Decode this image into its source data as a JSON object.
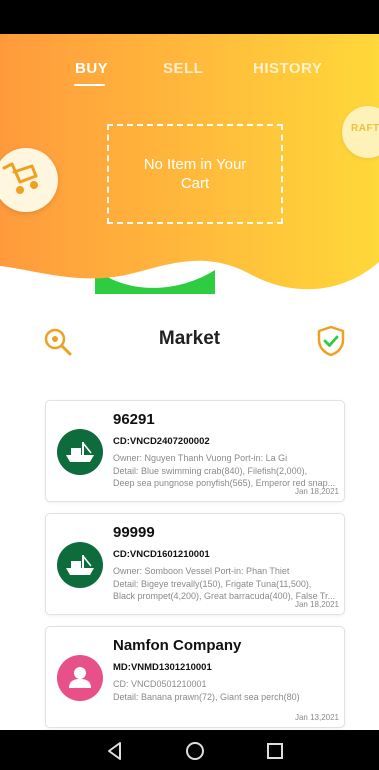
{
  "tabs": [
    {
      "label": "BUY",
      "active": true
    },
    {
      "label": "SELL",
      "active": false
    },
    {
      "label": "HISTORY",
      "active": false
    }
  ],
  "cart": {
    "empty_message": "No Item in Your Cart"
  },
  "hero": {
    "badge_text": "RAFT",
    "gradient_start": "#ff9a3c",
    "gradient_end": "#ffd83a",
    "wave_accent": "#2ecc40"
  },
  "market": {
    "title": "Market"
  },
  "listings": [
    {
      "name": "96291",
      "code": "CD:VNCD2407200002",
      "owner_line": "Owner: Nguyen Thanh Vuong  Port-in: La Gi",
      "detail_line1": "Detail: Blue swimming crab(840), Filefish(2,000),",
      "detail_line2": "Deep sea pungnose ponyfish(565), Emperor red snap...",
      "date": "Jan 18,2021",
      "avatar_icon": "boat-icon"
    },
    {
      "name": "99999",
      "code": "CD:VNCD1601210001",
      "owner_line": "Owner: Somboon Vessel  Port-in: Phan Thiet",
      "detail_line1": "Detail: Bigeye trevally(150), Frigate Tuna(11,500),",
      "detail_line2": "Black prompet(4,200), Great barracuda(400), False Tr...",
      "date": "Jan 18,2021",
      "avatar_icon": "boat-icon"
    },
    {
      "name": "Namfon Company",
      "code": "MD:VNMD1301210001",
      "owner_line": "CD: VNCD0501210001",
      "detail_line1": "Detail: Banana prawn(72), Giant sea perch(80)",
      "detail_line2": "",
      "date": "Jan 13,2021",
      "avatar_icon": "person-icon"
    }
  ],
  "colors": {
    "accent": "#f0a020",
    "boat_avatar": "#0e6b3c",
    "person_avatar": "#e8508a"
  }
}
